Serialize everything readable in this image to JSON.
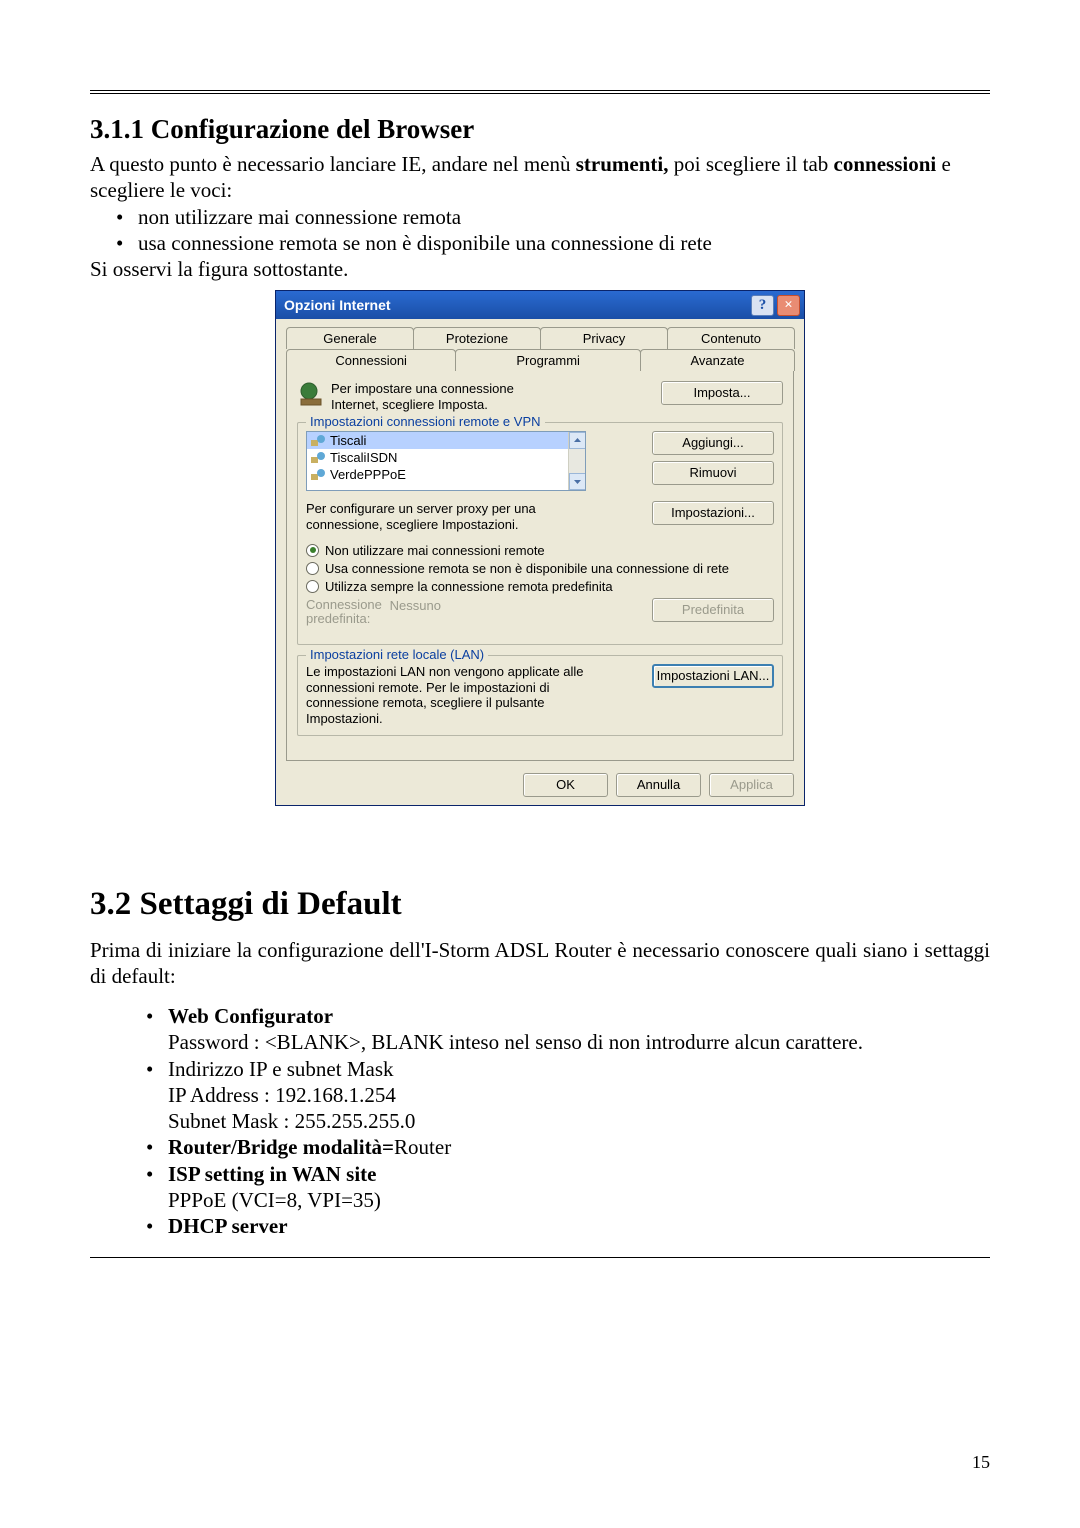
{
  "section": {
    "h311": "3.1.1 Configurazione del Browser",
    "intro_a": "A questo punto è necessario lanciare IE, andare nel menù ",
    "intro_bold1": "strumenti,",
    "intro_b": " poi scegliere il tab ",
    "intro_bold2": "connessioni",
    "intro_c": " e scegliere le voci:",
    "bullet1": "non utilizzare mai connessione remota",
    "bullet2": "usa connessione remota se non è disponibile una connessione di rete",
    "observe": "Si osservi la figura sottostante."
  },
  "dialog": {
    "title": "Opzioni Internet",
    "help": "?",
    "close": "×",
    "tabs_row1": {
      "t1": "Generale",
      "t2": "Protezione",
      "t3": "Privacy",
      "t4": "Contenuto"
    },
    "tabs_row2": {
      "t1": "Connessioni",
      "t2": "Programmi",
      "t3": "Avanzate"
    },
    "setup_text": "Per impostare una connessione Internet, scegliere Imposta.",
    "btn_imposta": "Imposta...",
    "group_vpn": "Impostazioni connessioni remote e VPN",
    "conn1": "Tiscali",
    "conn2": "TiscaliISDN",
    "conn3": "VerdePPPoE",
    "btn_aggiungi": "Aggiungi...",
    "btn_rimuovi": "Rimuovi",
    "proxy_text": "Per configurare un server proxy per una connessione, scegliere Impostazioni.",
    "btn_impostazioni": "Impostazioni...",
    "radio1": "Non utilizzare mai connessioni remote",
    "radio2": "Usa connessione remota se non è disponibile una connessione di rete",
    "radio3": "Utilizza sempre la connessione remota predefinita",
    "default_label": "Connessione predefinita:",
    "default_value": "Nessuno",
    "btn_predefinita": "Predefinita",
    "group_lan": "Impostazioni rete locale (LAN)",
    "lan_text": "Le impostazioni LAN non vengono applicate alle connessioni remote. Per le impostazioni di connessione remota, scegliere il pulsante Impostazioni.",
    "btn_lan": "Impostazioni LAN...",
    "ok": "OK",
    "cancel": "Annulla",
    "apply": "Applica"
  },
  "sec32": {
    "h": "3.2 Settaggi di Default",
    "intro": "Prima di iniziare la configurazione dell'I-Storm ADSL Router è necessario conoscere quali siano i settaggi di default:",
    "b1_bold": "Web Configurator",
    "b1_line": "Password : <BLANK>, BLANK inteso nel senso di non introdurre alcun carattere.",
    "b2_l1": "Indirizzo IP e subnet Mask",
    "b2_l2": "IP Address : 192.168.1.254",
    "b2_l3": "Subnet Mask : 255.255.255.0",
    "b3_bold": "Router/Bridge modalità=",
    "b3_rest": "Router",
    "b4_bold": "ISP setting in WAN site",
    "b4_line": "PPPoE (VCI=8, VPI=35)",
    "b5_bold": "DHCP server"
  },
  "page_number": "15"
}
